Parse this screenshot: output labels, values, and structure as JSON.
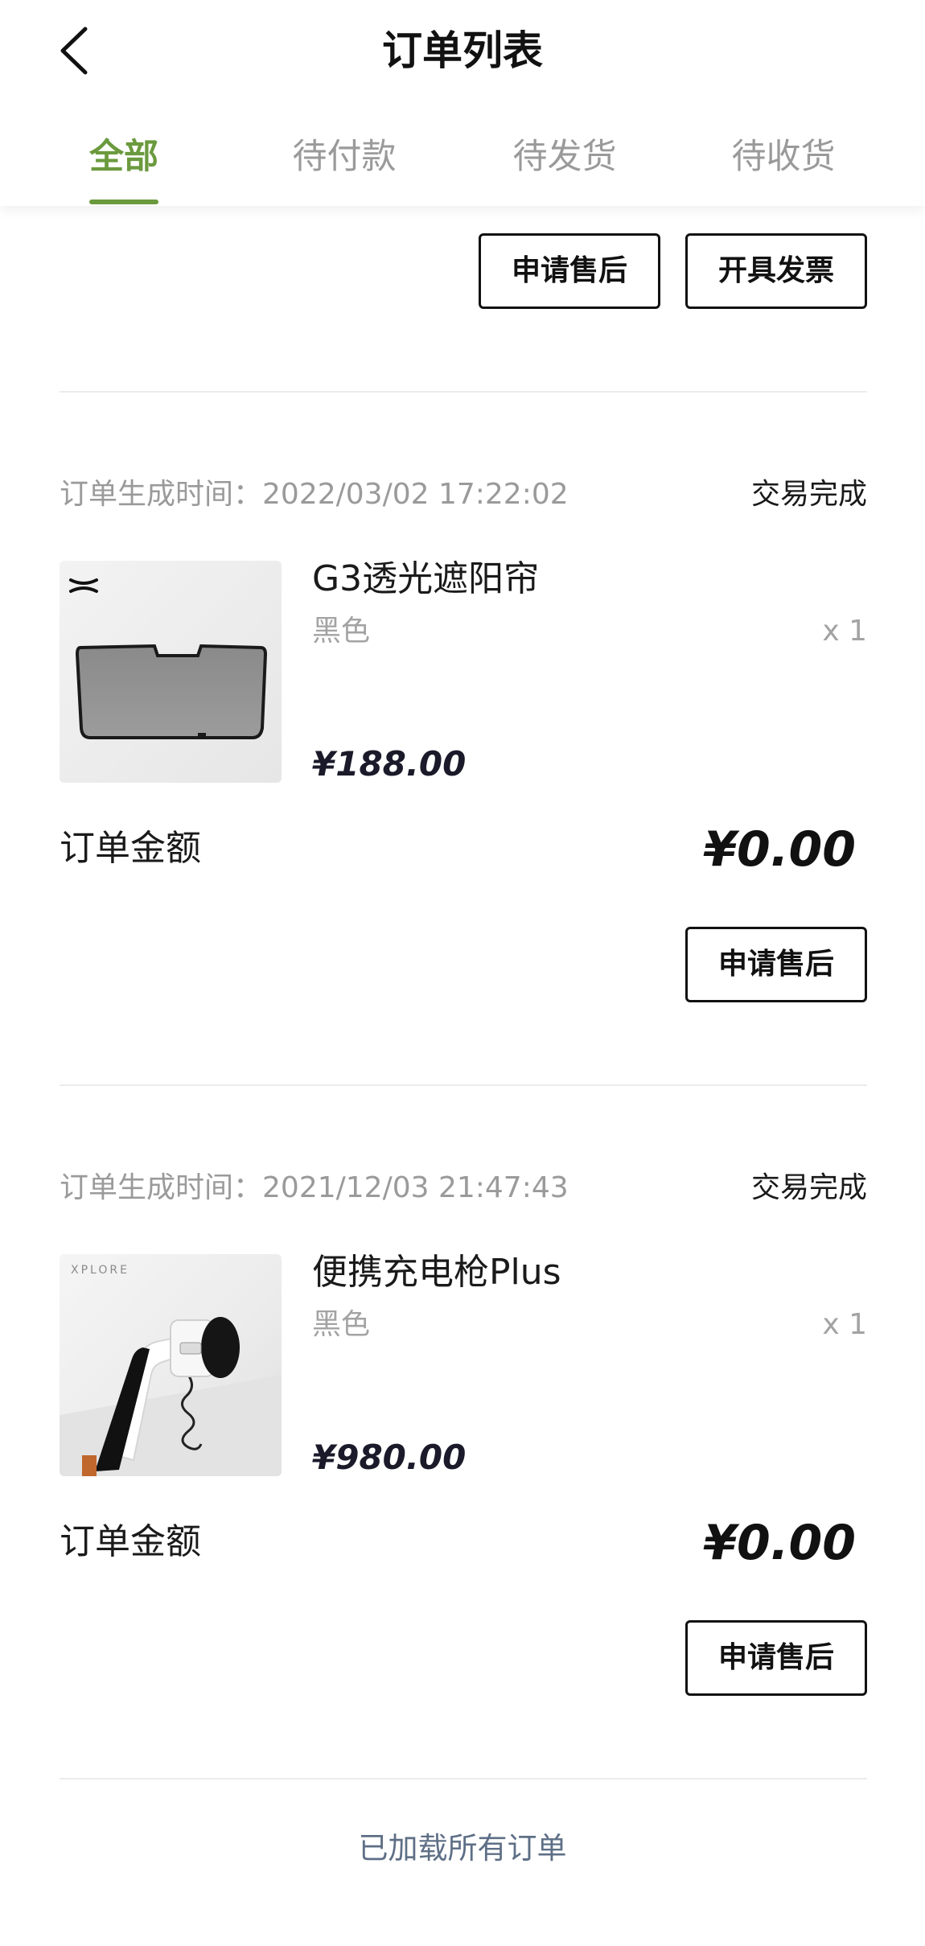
{
  "header": {
    "title": "订单列表",
    "back_icon": "chevron-left-icon"
  },
  "tabs": [
    {
      "label": "全部",
      "active": true
    },
    {
      "label": "待付款",
      "active": false
    },
    {
      "label": "待发货",
      "active": false
    },
    {
      "label": "待收货",
      "active": false
    }
  ],
  "top_actions": {
    "after_sales": "申请售后",
    "invoice": "开具发票"
  },
  "orders": [
    {
      "time_label": "订单生成时间：",
      "time": "2022/03/02 17:22:02",
      "status": "交易完成",
      "product": {
        "name": "G3透光遮阳帘",
        "variant": "黑色",
        "qty": "x 1",
        "price": "¥188.00"
      },
      "amount_label": "订单金额",
      "amount": "¥0.00",
      "action": "申请售后"
    },
    {
      "time_label": "订单生成时间：",
      "time": "2021/12/03 21:47:43",
      "status": "交易完成",
      "product": {
        "name": "便携充电枪Plus",
        "variant": "黑色",
        "qty": "x 1",
        "price": "¥980.00",
        "image_brand": "XPLORE"
      },
      "amount_label": "订单金额",
      "amount": "¥0.00",
      "action": "申请售后"
    }
  ],
  "footer": {
    "text": "已加载所有订单"
  },
  "colors": {
    "accent": "#6b9a3e",
    "muted": "#9a9a9a",
    "footer": "#5e6f86"
  }
}
